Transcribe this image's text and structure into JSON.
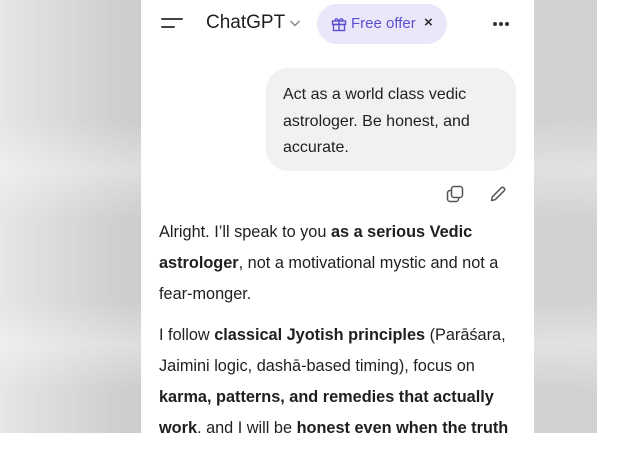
{
  "header": {
    "app_title": "ChatGPT",
    "offer_label": "Free offer",
    "offer_close": "×"
  },
  "icons": {
    "menu": "menu-lines-icon",
    "title_chevron": "chevron-down-icon",
    "gift": "gift-icon",
    "more": "more-dots-icon",
    "copy": "copy-icon",
    "edit": "edit-pencil-icon"
  },
  "user_message": {
    "text": "Act as a world class vedic astrologer. Be honest, and accurate."
  },
  "assistant_message": {
    "p1": {
      "t1": "Alright. I’ll speak to you ",
      "b1": "as a serious Vedic astrologer",
      "t2": ", not a motivational mystic and not a fear-monger."
    },
    "p2": {
      "t1": "I follow ",
      "b1": "classical Jyotish principles",
      "t2": " (Parāśara, Jaimini logic, dashā-based timing), focus on ",
      "b2": "karma, patterns, and remedies that actually work",
      "t3": ", and I will be ",
      "b3": "honest even when the truth"
    }
  },
  "colors": {
    "offer_pill_bg": "#ebe7fb",
    "offer_text": "#5a4fcf",
    "user_bubble_bg": "#f1f1f1",
    "text_primary": "#1f1f1f",
    "backdrop": "#d0d0d0"
  }
}
